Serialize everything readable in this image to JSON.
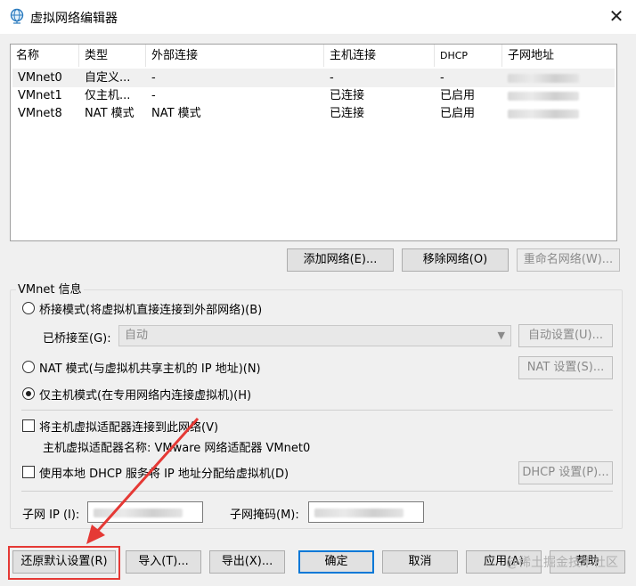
{
  "window": {
    "title": "虚拟网络编辑器",
    "close": "✕"
  },
  "table": {
    "columns": [
      "名称",
      "类型",
      "外部连接",
      "主机连接",
      "DHCP",
      "子网地址"
    ],
    "rows": [
      [
        "VMnet0",
        "自定义...",
        "-",
        "-",
        "-",
        ""
      ],
      [
        "VMnet1",
        "仅主机...",
        "-",
        "已连接",
        "已启用",
        ""
      ],
      [
        "VMnet8",
        "NAT 模式",
        "NAT 模式",
        "已连接",
        "已启用",
        ""
      ]
    ],
    "selected_row": 0
  },
  "network_buttons": {
    "add": "添加网络(E)...",
    "remove": "移除网络(O)",
    "rename": "重命名网络(W)..."
  },
  "vmnet_info": {
    "label": "VMnet 信息",
    "bridged": "桥接模式(将虚拟机直接连接到外部网络)(B)",
    "bridged_to_label": "已桥接至(G):",
    "bridged_to_value": "自动",
    "auto_settings": "自动设置(U)...",
    "nat": "NAT 模式(与虚拟机共享主机的 IP 地址)(N)",
    "nat_settings": "NAT 设置(S)...",
    "host_only": "仅主机模式(在专用网络内连接虚拟机)(H)",
    "selected_mode": "host_only",
    "connect_adapter": "将主机虚拟适配器连接到此网络(V)",
    "adapter_name": "主机虚拟适配器名称: VMware 网络适配器 VMnet0",
    "use_dhcp": "使用本地 DHCP 服务将 IP 地址分配给虚拟机(D)",
    "dhcp_settings": "DHCP 设置(P)...",
    "subnet_ip_label": "子网 IP (I):",
    "subnet_mask_label": "子网掩码(M):"
  },
  "bottom_buttons": {
    "restore": "还原默认设置(R)",
    "import": "导入(T)...",
    "export": "导出(X)...",
    "ok": "确定",
    "cancel": "取消",
    "apply": "应用(A)",
    "help": "帮助"
  },
  "watermark": "@稀土掘金技术社区",
  "colors": {
    "accent": "#0078d7",
    "highlight": "#e53935"
  }
}
